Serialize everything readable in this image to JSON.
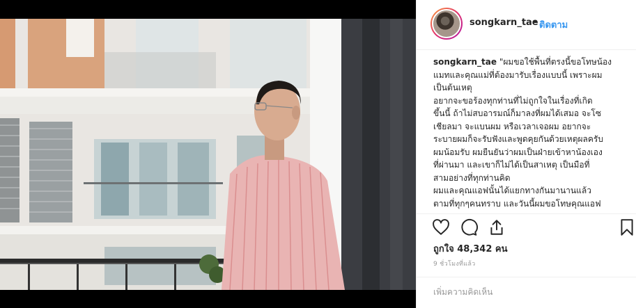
{
  "post": {
    "username": "songkarn_tae",
    "separator": "•",
    "follow_label": "ติดตาม",
    "caption_user": "songkarn_tae",
    "caption_lines": [
      "\"ผมขอใช้พื้นที่ตรงนี้ขอโทษน้อง",
      "แมทและคุณแม่ที่ต้องมารับเรื่องแบบนี้ เพราะผม",
      "เป็นต้นเหตุ",
      "อยากจะขอร้องทุกท่านที่ไม่ถูกใจในเรื่องที่เกิด",
      "ขึ้นนี้ ถ้าไม่สบอารมณ์ก็มาลงที่ผมได้เสมอ จะโซ",
      "เชียลมา จะแบนผม หรือเวลาเจอผม อยากจะ",
      "ระบายผมก็จะรับฟังและพูดคุยกันด้วยเหตุผลครับ",
      "ผมน้อมรับ ผมยืนยันว่าผมเป็นฝ่ายเข้าหาน้องเอง",
      "ที่ผ่านมา และเขาก็ไม่ได้เป็นสาเหตุ เป็นมือที่",
      "สามอย่างที่ทุกท่านคิด",
      "ผมและคุณแอฟนั้นได้แยกทางกันมานานแล้ว",
      "ตามที่ทุกๆคนทราบ และวันนี้ผมขอโทษคุณแอฟ"
    ],
    "likes_text": "ถูกใจ 48,342 คน",
    "time_text": "9 ชั่วโมงที่แล้ว",
    "comment_placeholder": "เพิ่มความคิดเห็น"
  },
  "icons": {
    "like": "heart-icon",
    "comment": "comment-icon",
    "share": "share-icon",
    "save": "bookmark-icon"
  },
  "colors": {
    "follow": "#3897f0",
    "text": "#262626",
    "muted": "#999999",
    "border": "#efefef"
  }
}
